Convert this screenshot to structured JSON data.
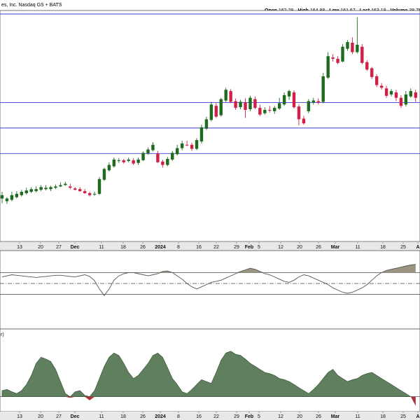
{
  "header": {
    "symbol_text": "es, Inc. Nasdaq GS + BATS",
    "quote": [
      {
        "label": "Open",
        "value": "162.28"
      },
      {
        "label": "High",
        "value": "164.88"
      },
      {
        "label": "Low",
        "value": "161.67"
      },
      {
        "label": "Last",
        "value": "163.18"
      },
      {
        "label": "Volume",
        "value": "38.7M"
      }
    ]
  },
  "colors": {
    "up": "#1e6b1e",
    "down": "#d21f45",
    "hline": "#3a3ad8",
    "osc_fill": "#9b9480",
    "area_fill": "#5f7f5f",
    "area_neg": "#b03040",
    "axis_band": "#e8e8e8",
    "grid": "#dddddd"
  },
  "x_axis_labels": [
    {
      "text": "13",
      "bold": false
    },
    {
      "text": "20",
      "bold": false
    },
    {
      "text": "27",
      "bold": false
    },
    {
      "text": "Dec",
      "bold": true
    },
    {
      "text": "11",
      "bold": false
    },
    {
      "text": "18",
      "bold": false
    },
    {
      "text": "26",
      "bold": false
    },
    {
      "text": "2024",
      "bold": true
    },
    {
      "text": "8",
      "bold": false
    },
    {
      "text": "16",
      "bold": false
    },
    {
      "text": "22",
      "bold": false
    },
    {
      "text": "29",
      "bold": false
    },
    {
      "text": "Feb",
      "bold": true
    },
    {
      "text": "5",
      "bold": false
    },
    {
      "text": "12",
      "bold": false
    },
    {
      "text": "20",
      "bold": false
    },
    {
      "text": "26",
      "bold": false
    },
    {
      "text": "Mar",
      "bold": true
    },
    {
      "text": "11",
      "bold": false
    },
    {
      "text": "18",
      "bold": false
    },
    {
      "text": "25",
      "bold": false
    },
    {
      "text": "A",
      "bold": true
    }
  ],
  "panel3_title": "r)",
  "chart_data": [
    {
      "type": "candlestick",
      "title": "",
      "ylim": [
        10,
        354
      ],
      "horizontal_lines": [
        147,
        185,
        223
      ],
      "candles": [
        [
          290,
          285,
          280,
          297
        ],
        [
          294,
          290,
          288,
          298
        ],
        [
          292,
          285,
          280,
          294
        ],
        [
          288,
          283,
          279,
          290
        ],
        [
          285,
          280,
          277,
          287
        ],
        [
          282,
          278,
          274,
          284
        ],
        [
          280,
          276,
          273,
          282
        ],
        [
          279,
          276,
          272,
          281
        ],
        [
          277,
          273,
          270,
          279
        ],
        [
          276,
          274,
          270,
          278
        ],
        [
          276,
          273,
          271,
          279
        ],
        [
          274,
          272,
          269,
          276
        ],
        [
          272,
          270,
          266,
          273
        ],
        [
          270,
          268,
          265,
          271
        ],
        [
          272,
          274,
          268,
          276
        ],
        [
          275,
          277,
          273,
          278
        ],
        [
          276,
          279,
          273,
          280
        ],
        [
          279,
          282,
          276,
          283
        ],
        [
          282,
          285,
          280,
          287
        ],
        [
          284,
          283,
          280,
          286
        ],
        [
          283,
          261,
          258,
          285
        ],
        [
          262,
          246,
          244,
          264
        ],
        [
          248,
          240,
          236,
          250
        ],
        [
          242,
          232,
          229,
          244
        ],
        [
          234,
          233,
          230,
          237
        ],
        [
          233,
          236,
          231,
          238
        ],
        [
          234,
          232,
          229,
          236
        ],
        [
          233,
          238,
          230,
          240
        ],
        [
          237,
          232,
          229,
          240
        ],
        [
          233,
          222,
          220,
          234
        ],
        [
          223,
          217,
          214,
          225
        ],
        [
          218,
          210,
          206,
          220
        ],
        [
          223,
          236,
          219,
          237
        ],
        [
          235,
          240,
          232,
          244
        ],
        [
          240,
          231,
          228,
          242
        ],
        [
          232,
          222,
          219,
          234
        ],
        [
          224,
          215,
          210,
          226
        ],
        [
          215,
          208,
          204,
          218
        ],
        [
          210,
          210,
          204,
          212
        ],
        [
          210,
          216,
          207,
          219
        ],
        [
          216,
          203,
          200,
          218
        ],
        [
          205,
          184,
          180,
          208
        ],
        [
          186,
          172,
          168,
          188
        ],
        [
          173,
          150,
          146,
          175
        ],
        [
          152,
          168,
          148,
          170
        ],
        [
          166,
          142,
          140,
          168
        ],
        [
          144,
          128,
          125,
          147
        ],
        [
          130,
          146,
          127,
          148
        ],
        [
          145,
          155,
          141,
          158
        ],
        [
          154,
          146,
          143,
          157
        ],
        [
          147,
          158,
          141,
          170
        ],
        [
          157,
          140,
          137,
          160
        ],
        [
          142,
          155,
          138,
          157
        ],
        [
          155,
          165,
          150,
          167
        ],
        [
          163,
          158,
          154,
          165
        ],
        [
          158,
          159,
          152,
          162
        ],
        [
          160,
          155,
          152,
          164
        ],
        [
          156,
          148,
          140,
          158
        ],
        [
          150,
          136,
          132,
          152
        ],
        [
          138,
          130,
          128,
          143
        ],
        [
          132,
          154,
          129,
          156
        ],
        [
          153,
          172,
          150,
          181
        ],
        [
          171,
          178,
          167,
          180
        ],
        [
          160,
          145,
          142,
          163
        ],
        [
          147,
          144,
          140,
          150
        ],
        [
          145,
          147,
          141,
          150
        ],
        [
          146,
          108,
          103,
          148
        ],
        [
          110,
          78,
          72,
          112
        ],
        [
          80,
          82,
          75,
          86
        ],
        [
          82,
          88,
          78,
          90
        ],
        [
          86,
          64,
          60,
          87
        ],
        [
          67,
          57,
          54,
          70
        ],
        [
          58,
          72,
          50,
          75
        ],
        [
          72,
          61,
          20,
          74
        ],
        [
          64,
          88,
          60,
          90
        ],
        [
          87,
          98,
          84,
          100
        ],
        [
          96,
          109,
          94,
          112
        ],
        [
          108,
          121,
          105,
          124
        ],
        [
          122,
          125,
          118,
          128
        ],
        [
          126,
          137,
          122,
          140
        ],
        [
          135,
          130,
          127,
          138
        ],
        [
          132,
          140,
          128,
          145
        ],
        [
          140,
          152,
          136,
          155
        ],
        [
          150,
          135,
          130,
          153
        ],
        [
          138,
          130,
          126,
          140
        ],
        [
          132,
          140,
          128,
          146
        ]
      ]
    },
    {
      "type": "area",
      "title": "",
      "ylim": [
        0,
        100
      ],
      "reference_lines": [
        30,
        50,
        70
      ],
      "values": [
        62,
        64,
        66,
        65,
        64,
        63,
        62,
        61,
        62,
        63,
        64,
        65,
        65,
        64,
        63,
        62,
        64,
        66,
        63,
        55,
        40,
        28,
        40,
        56,
        64,
        68,
        70,
        70,
        68,
        66,
        64,
        66,
        68,
        72,
        73,
        70,
        64,
        58,
        50,
        44,
        40,
        44,
        48,
        52,
        54,
        56,
        60,
        64,
        68,
        72,
        75,
        78,
        76,
        72,
        68,
        66,
        62,
        58,
        54,
        52,
        56,
        62,
        66,
        64,
        60,
        56,
        52,
        48,
        42,
        38,
        34,
        32,
        34,
        38,
        42,
        48,
        56,
        64,
        70,
        74,
        76,
        78,
        80,
        82,
        84,
        85
      ]
    },
    {
      "type": "area",
      "title": "",
      "ylim": [
        -20,
        100
      ],
      "values": [
        10,
        12,
        8,
        5,
        10,
        20,
        35,
        55,
        65,
        62,
        58,
        45,
        25,
        5,
        -2,
        8,
        10,
        2,
        -6,
        10,
        30,
        50,
        65,
        72,
        68,
        55,
        40,
        30,
        35,
        45,
        55,
        68,
        72,
        65,
        48,
        30,
        20,
        8,
        5,
        12,
        20,
        28,
        25,
        22,
        40,
        60,
        72,
        75,
        70,
        68,
        62,
        55,
        50,
        45,
        40,
        38,
        35,
        30,
        28,
        25,
        20,
        15,
        10,
        5,
        12,
        20,
        30,
        40,
        45,
        35,
        30,
        25,
        28,
        30,
        35,
        38,
        40,
        35,
        30,
        25,
        20,
        15,
        10,
        5,
        0,
        -15
      ]
    }
  ]
}
